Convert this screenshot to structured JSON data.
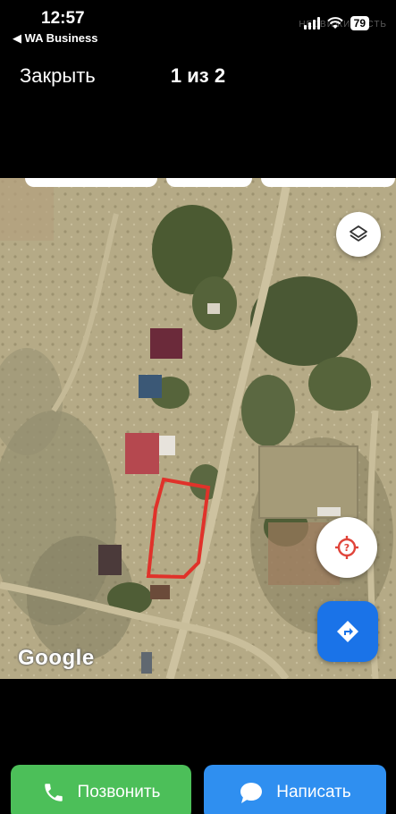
{
  "status_bar": {
    "time": "12:57",
    "back_app": "◀ WA Business",
    "battery": "79",
    "watermark": "НЕДВИЖИМОСТЬ"
  },
  "header": {
    "close_label": "Закрыть",
    "counter": "1 из 2"
  },
  "map": {
    "logo": "Google",
    "layers_icon": "layers-icon",
    "locate_icon": "locate-icon",
    "directions_icon": "directions-icon",
    "plot_outline_color": "#e0322a"
  },
  "actions": {
    "call_label": "Позвонить",
    "write_label": "Написать",
    "call_color": "#4cbf59",
    "write_color": "#2f8ff0"
  }
}
